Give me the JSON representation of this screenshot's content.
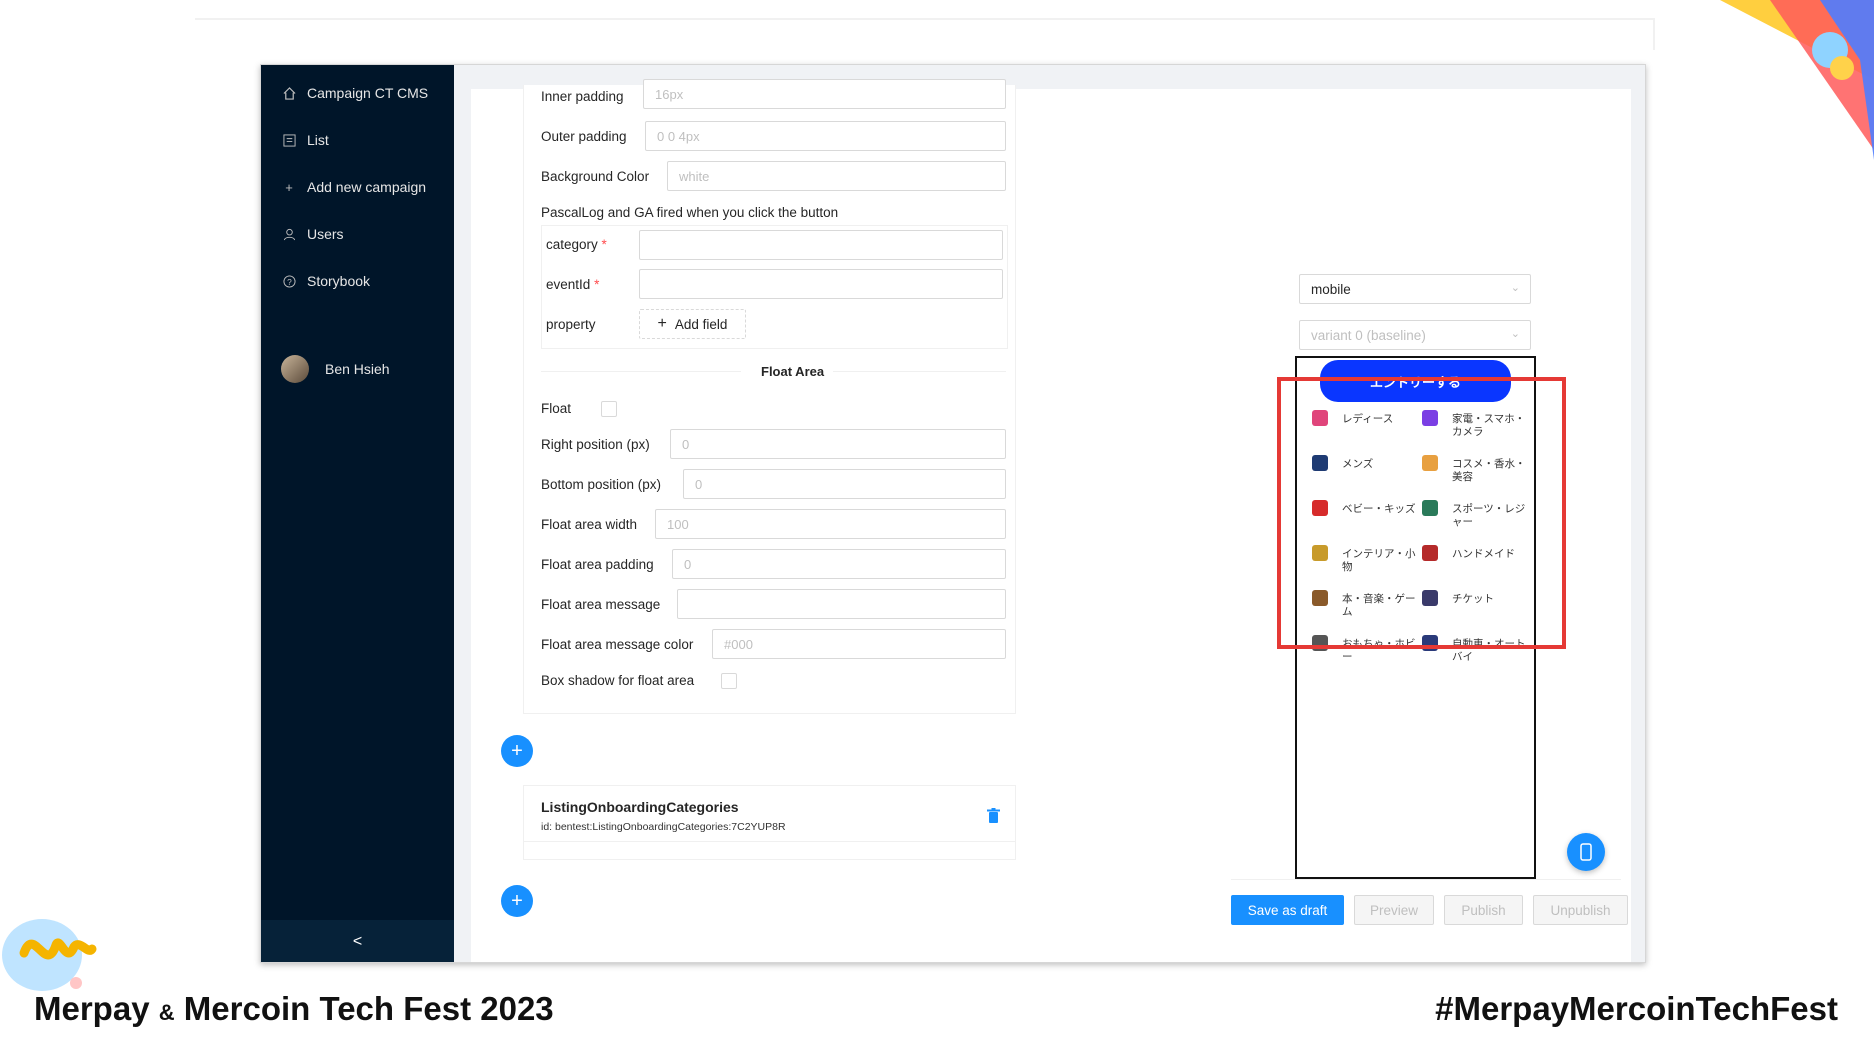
{
  "sidebar": {
    "items": [
      {
        "label": "Campaign CT CMS",
        "icon": "home-icon"
      },
      {
        "label": "List",
        "icon": "list-icon"
      },
      {
        "label": "Add new campaign",
        "icon": "plus-icon"
      },
      {
        "label": "Users",
        "icon": "user-icon"
      },
      {
        "label": "Storybook",
        "icon": "question-circle-icon"
      }
    ],
    "user_name": "Ben Hsieh",
    "collapse_glyph": "<"
  },
  "form": {
    "inner_padding": {
      "label": "Inner padding",
      "placeholder": "16px"
    },
    "outer_padding": {
      "label": "Outer padding",
      "placeholder": "0 0 4px"
    },
    "background_color": {
      "label": "Background Color",
      "placeholder": "white"
    },
    "pascal_caption": "PascalLog and GA fired when you click the button",
    "category_label": "category",
    "eventid_label": "eventId",
    "required_mark": "*",
    "property_label": "property",
    "add_field": "Add field",
    "float_area_title": "Float Area",
    "float_label": "Float",
    "right_position": {
      "label": "Right position (px)",
      "placeholder": "0"
    },
    "bottom_position": {
      "label": "Bottom position (px)",
      "placeholder": "0"
    },
    "float_area_width": {
      "label": "Float area width",
      "placeholder": "100"
    },
    "float_area_padding": {
      "label": "Float area padding",
      "placeholder": "0"
    },
    "float_area_message": {
      "label": "Float area message",
      "placeholder": ""
    },
    "float_area_message_color": {
      "label": "Float area message color",
      "placeholder": "#000"
    },
    "box_shadow_label": "Box shadow for float area"
  },
  "component": {
    "title": "ListingOnboardingCategories",
    "id_text": "id: bentest:ListingOnboardingCategories:7C2YUP8R"
  },
  "preview": {
    "device_select": "mobile",
    "variant_select": "variant 0 (baseline)",
    "entry_button": "エントリーする",
    "categories": [
      {
        "label": "レディース",
        "color": "#e0457b"
      },
      {
        "label": "家電・スマホ・カメラ",
        "color": "#7b3fe4"
      },
      {
        "label": "メンズ",
        "color": "#1f3b73"
      },
      {
        "label": "コスメ・香水・美容",
        "color": "#e8a040"
      },
      {
        "label": "ベビー・キッズ",
        "color": "#d62b2b"
      },
      {
        "label": "スポーツ・レジャー",
        "color": "#2a7a5a"
      },
      {
        "label": "インテリア・小物",
        "color": "#c89b2b"
      },
      {
        "label": "ハンドメイド",
        "color": "#b52a2a"
      },
      {
        "label": "本・音楽・ゲーム",
        "color": "#8a5a2a"
      },
      {
        "label": "チケット",
        "color": "#3a3a6a"
      },
      {
        "label": "おもちゃ・ホビー",
        "color": "#555555"
      },
      {
        "label": "自動車・オートバイ",
        "color": "#2a3a7a"
      }
    ]
  },
  "actions": {
    "save_draft": "Save as draft",
    "preview": "Preview",
    "publish": "Publish",
    "unpublish": "Unpublish"
  },
  "footer": {
    "event_part1": "Merpay",
    "event_amp": "&",
    "event_part2": "Mercoin Tech Fest 2023",
    "hashtag": "#MerpayMercoinTechFest"
  },
  "colors": {
    "primary": "#1890ff",
    "sidebar_bg": "#001529",
    "entry_button": "#0a36ff",
    "highlight_box": "#e53935"
  }
}
